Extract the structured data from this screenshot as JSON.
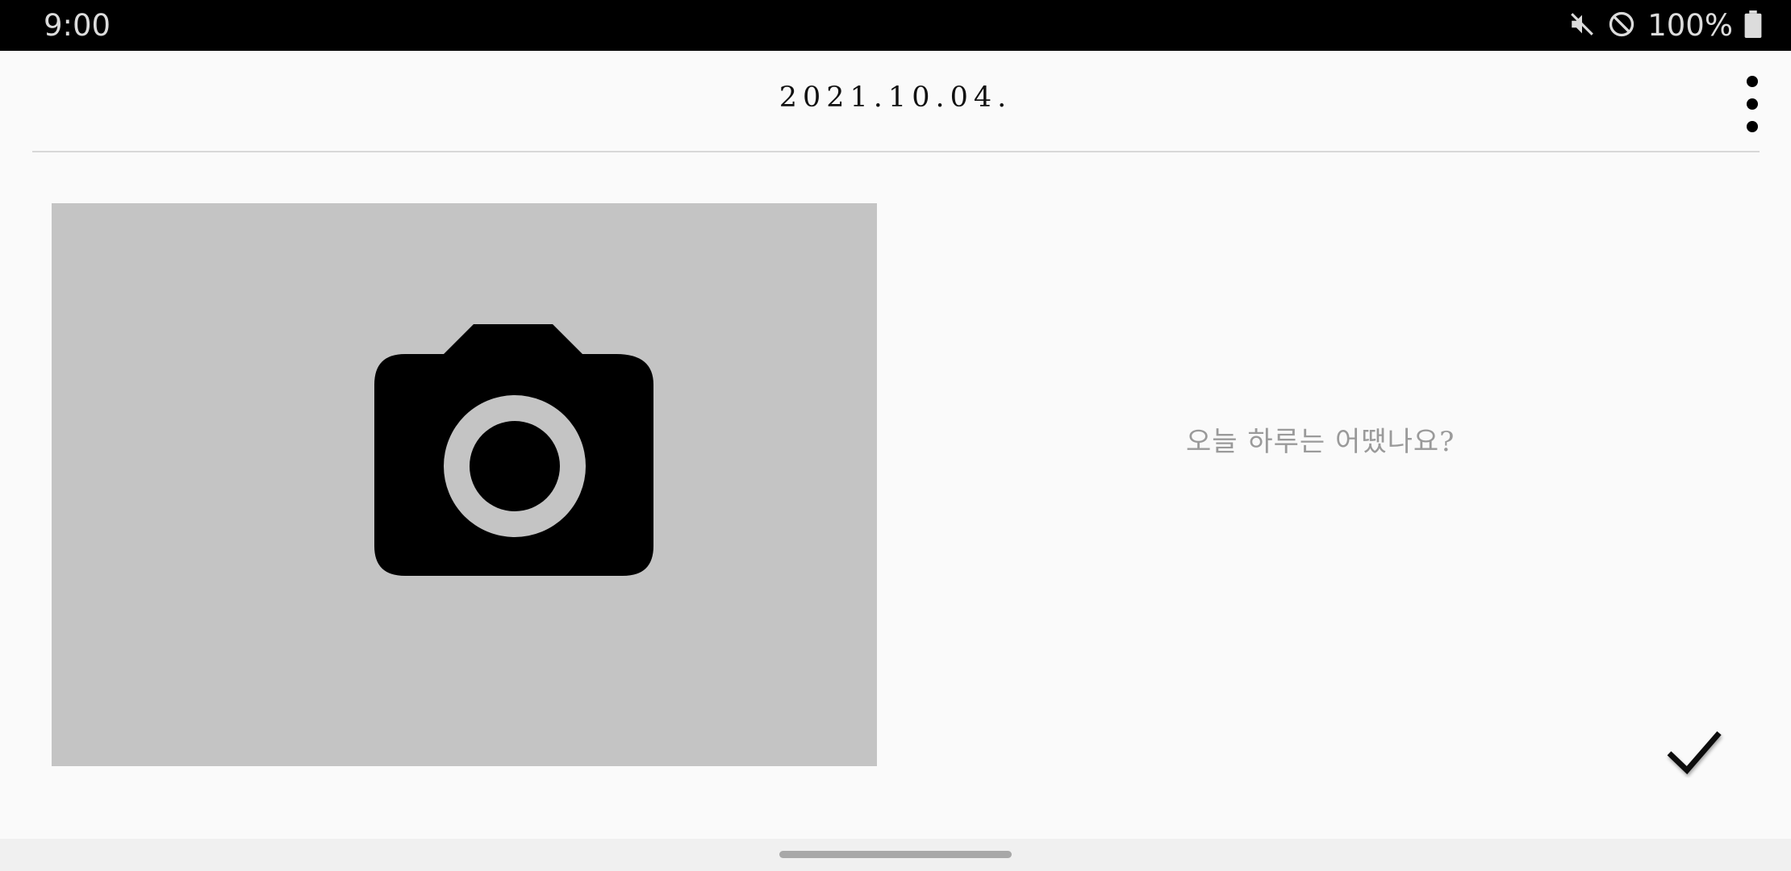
{
  "status_bar": {
    "time": "9:00",
    "battery": "100%",
    "icons": [
      "mute-icon",
      "do-not-disturb-icon",
      "battery-icon"
    ]
  },
  "app_bar": {
    "date": "2021.10.04.",
    "more_icon": "more-vert-icon"
  },
  "photo": {
    "placeholder_icon": "camera-icon",
    "background_color": "#c4c4c4"
  },
  "diary": {
    "placeholder": "오늘 하루는 어땠나요?",
    "confirm_icon": "check-icon"
  }
}
